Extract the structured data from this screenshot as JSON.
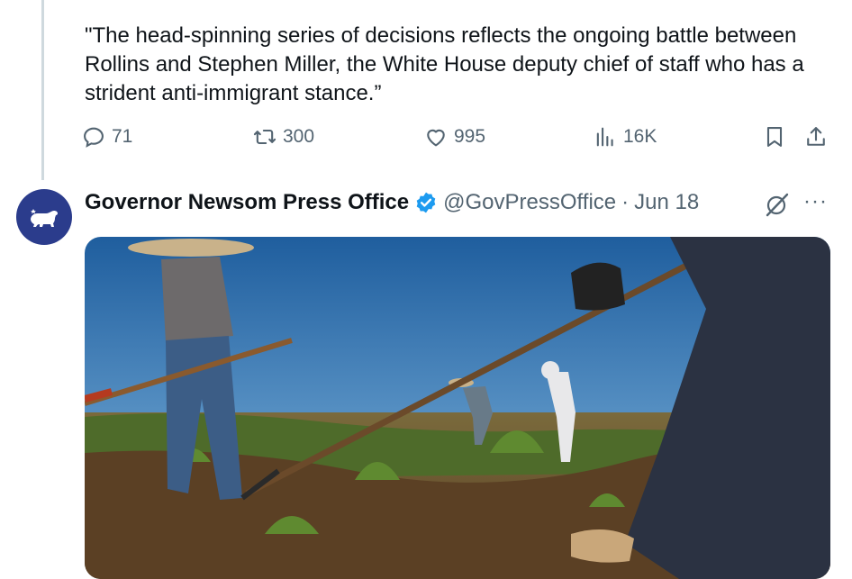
{
  "tweet_above": {
    "quote_text": "\"The head-spinning series of decisions reflects the ongoing battle between Rollins and Stephen Miller, the White House deputy chief of staff who has a strident anti-immigrant stance.”",
    "actions": {
      "replies": "71",
      "reposts": "300",
      "likes": "995",
      "views": "16K"
    }
  },
  "tweet": {
    "author_name": "Governor Newsom Press Office",
    "handle": "@GovPressOffice",
    "separator": "·",
    "date": "Jun 18",
    "more_label": "···"
  },
  "colors": {
    "accent_blue": "#1d9bf0",
    "avatar_bg": "#2b3c8c",
    "secondary_text": "#536471"
  },
  "icons": [
    "reply-icon",
    "repost-icon",
    "like-icon",
    "views-icon",
    "bookmark-icon",
    "share-icon",
    "verified-badge-icon",
    "grok-icon",
    "bear-logo-icon"
  ]
}
